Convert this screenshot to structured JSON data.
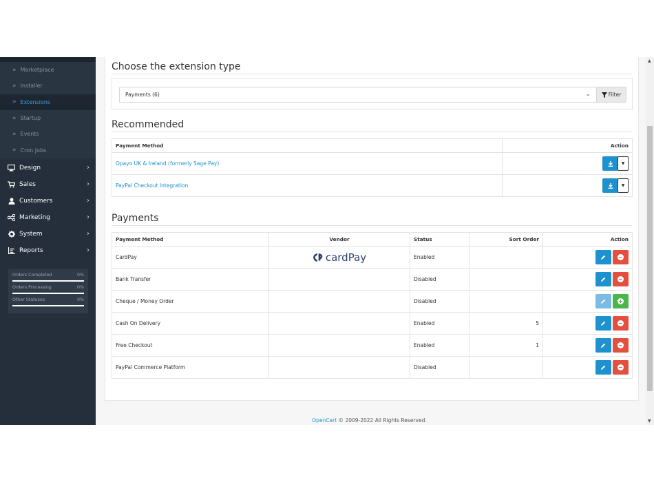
{
  "sidebar": {
    "sub_items": [
      {
        "label": "Marketplace",
        "active": false
      },
      {
        "label": "Installer",
        "active": false
      },
      {
        "label": "Extensions",
        "active": true
      },
      {
        "label": "Startup",
        "active": false
      },
      {
        "label": "Events",
        "active": false
      },
      {
        "label": "Cron Jobs",
        "active": false
      }
    ],
    "nav": [
      {
        "label": "Design",
        "icon": "monitor-icon"
      },
      {
        "label": "Sales",
        "icon": "cart-icon"
      },
      {
        "label": "Customers",
        "icon": "user-icon"
      },
      {
        "label": "Marketing",
        "icon": "share-icon"
      },
      {
        "label": "System",
        "icon": "gear-icon"
      },
      {
        "label": "Reports",
        "icon": "chart-icon"
      }
    ],
    "stats": [
      {
        "label": "Orders Completed",
        "value": "0%"
      },
      {
        "label": "Orders Processing",
        "value": "0%"
      },
      {
        "label": "Other Statuses",
        "value": "0%"
      }
    ]
  },
  "extension_type": {
    "heading": "Choose the extension type",
    "selected": "Payments (6)",
    "filter_label": "Filter"
  },
  "recommended": {
    "heading": "Recommended",
    "col_method": "Payment Method",
    "col_action": "Action",
    "rows": [
      {
        "name": "Opayo UK & Ireland (formerly Sage Pay)"
      },
      {
        "name": "PayPal Checkout Integration"
      }
    ]
  },
  "payments": {
    "heading": "Payments",
    "col_method": "Payment Method",
    "col_vendor": "Vendor",
    "col_status": "Status",
    "col_sort": "Sort Order",
    "col_action": "Action",
    "vendor_logo_text": "cardPay",
    "rows": [
      {
        "name": "CardPay",
        "vendor": "cardpay-logo",
        "status": "Enabled",
        "sort": "",
        "installed": true
      },
      {
        "name": "Bank Transfer",
        "vendor": "",
        "status": "Disabled",
        "sort": "",
        "installed": true
      },
      {
        "name": "Cheque / Money Order",
        "vendor": "",
        "status": "Disabled",
        "sort": "",
        "installed": false
      },
      {
        "name": "Cash On Delivery",
        "vendor": "",
        "status": "Enabled",
        "sort": "5",
        "installed": true
      },
      {
        "name": "Free Checkout",
        "vendor": "",
        "status": "Enabled",
        "sort": "1",
        "installed": true
      },
      {
        "name": "PayPal Commerce Platform",
        "vendor": "",
        "status": "Disabled",
        "sort": "",
        "installed": true
      }
    ]
  },
  "footer": {
    "brand": "OpenCart",
    "copyright": " © 2009-2022 All Rights Reserved."
  },
  "colors": {
    "sidebar_bg": "#242f3b",
    "link": "#1e91cf",
    "btn_primary": "#1e91cf",
    "btn_danger": "#e3503e",
    "btn_success": "#4cb64c"
  }
}
